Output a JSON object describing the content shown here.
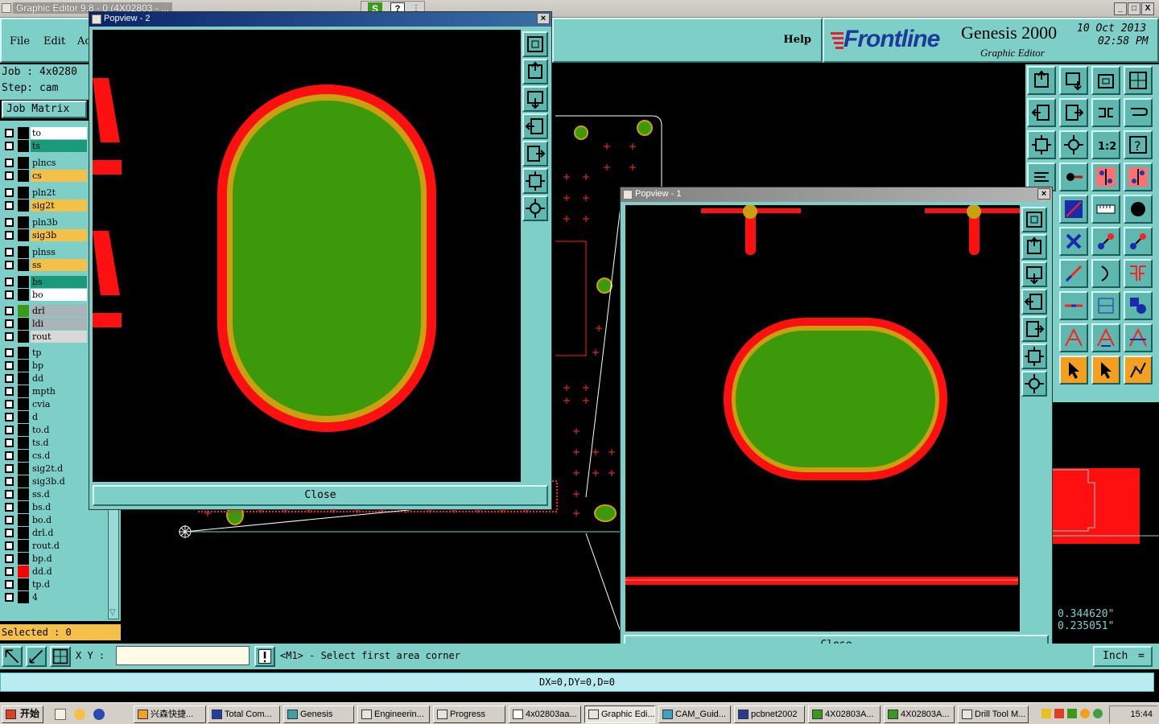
{
  "window": {
    "title": "Graphic Editor 9.8 - 0 (4X02803 - ...",
    "min": "_",
    "max": "□",
    "close": "X"
  },
  "menus": [
    {
      "label": "File"
    },
    {
      "label": "Edit"
    },
    {
      "label": "Ac"
    }
  ],
  "help_label": "Help",
  "brand": {
    "logo": "Frontline",
    "product": "Genesis 2000",
    "subtitle": "Graphic Editor",
    "date": "10 Oct 2013",
    "time": "02:58 PM"
  },
  "job": {
    "job_line": "Job : 4x0280",
    "step_line": "Step: cam"
  },
  "job_matrix_label": "Job Matrix",
  "layers": [
    {
      "name": "to",
      "color": "#ffffff",
      "swatch": "#000000"
    },
    {
      "name": "ts",
      "color": "#1a9a7a",
      "swatch": "#000000"
    },
    {
      "name": "plncs",
      "color": "#7fcfc9",
      "swatch": "#000000"
    },
    {
      "name": "cs",
      "color": "#f3c04a",
      "swatch": "#000000"
    },
    {
      "name": "pln2t",
      "color": "#7fcfc9",
      "swatch": "#000000"
    },
    {
      "name": "sig2t",
      "color": "#f3c04a",
      "swatch": "#000000"
    },
    {
      "name": "pln3b",
      "color": "#7fcfc9",
      "swatch": "#000000"
    },
    {
      "name": "sig3b",
      "color": "#f3c04a",
      "swatch": "#000000"
    },
    {
      "name": "plnss",
      "color": "#7fcfc9",
      "swatch": "#000000"
    },
    {
      "name": "ss",
      "color": "#f3c04a",
      "swatch": "#000000"
    },
    {
      "name": "bs",
      "color": "#1a9a7a",
      "swatch": "#000000"
    },
    {
      "name": "bo",
      "color": "#ffffff",
      "swatch": "#000000"
    },
    {
      "name": "drl",
      "color": "#a9b4b8",
      "swatch": "#3a9b1a"
    },
    {
      "name": "ldi",
      "color": "#a9b4b8",
      "swatch": "#000000"
    },
    {
      "name": "rout",
      "color": "#d8d8d8",
      "swatch": "#000000"
    },
    {
      "name": "tp",
      "color": "#7fcfc9",
      "swatch": "#000000"
    },
    {
      "name": "bp",
      "color": "#7fcfc9",
      "swatch": "#000000"
    },
    {
      "name": "dd",
      "color": "#7fcfc9",
      "swatch": "#000000"
    },
    {
      "name": "mpth",
      "color": "#7fcfc9",
      "swatch": "#000000"
    },
    {
      "name": "cvia",
      "color": "#7fcfc9",
      "swatch": "#000000"
    },
    {
      "name": "d",
      "color": "#7fcfc9",
      "swatch": "#000000"
    },
    {
      "name": "to.d",
      "color": "#7fcfc9",
      "swatch": "#000000"
    },
    {
      "name": "ts.d",
      "color": "#7fcfc9",
      "swatch": "#000000"
    },
    {
      "name": "cs.d",
      "color": "#7fcfc9",
      "swatch": "#000000"
    },
    {
      "name": "sig2t.d",
      "color": "#7fcfc9",
      "swatch": "#000000"
    },
    {
      "name": "sig3b.d",
      "color": "#7fcfc9",
      "swatch": "#000000"
    },
    {
      "name": "ss.d",
      "color": "#7fcfc9",
      "swatch": "#000000"
    },
    {
      "name": "bs.d",
      "color": "#7fcfc9",
      "swatch": "#000000"
    },
    {
      "name": "bo.d",
      "color": "#7fcfc9",
      "swatch": "#000000"
    },
    {
      "name": "drl.d",
      "color": "#7fcfc9",
      "swatch": "#000000"
    },
    {
      "name": "rout.d",
      "color": "#7fcfc9",
      "swatch": "#000000"
    },
    {
      "name": "bp.d",
      "color": "#7fcfc9",
      "swatch": "#000000"
    },
    {
      "name": "dd.d",
      "color": "#7fcfc9",
      "swatch": "#ff0000"
    },
    {
      "name": "tp.d",
      "color": "#7fcfc9",
      "swatch": "#000000"
    },
    {
      "name": "4",
      "color": "#7fcfc9",
      "swatch": "#000000"
    }
  ],
  "selected_label": "Selected : 0",
  "popview2": {
    "title": "Popview - 2",
    "close_label": "Close"
  },
  "popview1": {
    "title": "Popview - 1",
    "close_label": "Close"
  },
  "command": {
    "xy_label": "X Y :",
    "xy_value": "",
    "message": "<M1> - Select first area corner"
  },
  "status_line": "DX=0,DY=0,D=0",
  "coords": {
    "x": "0.344620\"",
    "y": "0.235051\""
  },
  "unit_label": "Inch",
  "taskbar": {
    "start": "开始",
    "tasks": [
      {
        "label": "兴森快捷..."
      },
      {
        "label": "Total Com..."
      },
      {
        "label": "Genesis"
      },
      {
        "label": "Engineerin..."
      },
      {
        "label": "Progress"
      },
      {
        "label": "4x02803aa..."
      },
      {
        "label": "Graphic Edi..."
      },
      {
        "label": "CAM_Guid..."
      },
      {
        "label": "pcbnet2002"
      },
      {
        "label": "4X02803A..."
      },
      {
        "label": "4X02803A..."
      },
      {
        "label": "Drill Tool M..."
      }
    ],
    "clock": "15:44"
  },
  "colors": {
    "pad_fill": "#3c9a0a",
    "pad_ring": "#c8a010",
    "pad_outer": "#ff0000",
    "teal": "#7fcfc9"
  }
}
